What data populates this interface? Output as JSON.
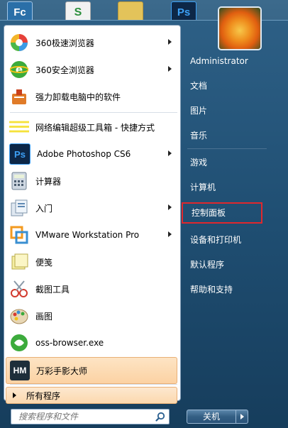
{
  "desktop": {
    "top_icons": [
      {
        "glyph": "Fc"
      },
      {
        "glyph": "S"
      },
      {
        "glyph": ""
      },
      {
        "glyph": "Ps"
      }
    ]
  },
  "left_pane": {
    "programs": [
      {
        "label": "360极速浏览器",
        "icon": "360-speed-browser-icon",
        "has_submenu": true
      },
      {
        "label": "360安全浏览器",
        "icon": "360-safe-browser-icon",
        "has_submenu": true
      },
      {
        "label": "强力卸载电脑中的软件",
        "icon": "uninstaller-icon",
        "has_submenu": false
      },
      {
        "label": "网络编辑超级工具箱 - 快捷方式",
        "icon": "toolbox-shortcut-icon",
        "has_submenu": false
      },
      {
        "label": "Adobe Photoshop CS6",
        "icon": "photoshop-icon",
        "has_submenu": true
      },
      {
        "label": "计算器",
        "icon": "calculator-icon",
        "has_submenu": false
      },
      {
        "label": "入门",
        "icon": "getting-started-icon",
        "has_submenu": true
      },
      {
        "label": "VMware Workstation Pro",
        "icon": "vmware-icon",
        "has_submenu": true
      },
      {
        "label": "便笺",
        "icon": "sticky-notes-icon",
        "has_submenu": false
      },
      {
        "label": "截图工具",
        "icon": "snipping-tool-icon",
        "has_submenu": false
      },
      {
        "label": "画图",
        "icon": "paint-icon",
        "has_submenu": false
      },
      {
        "label": "oss-browser.exe",
        "icon": "oss-browser-icon",
        "has_submenu": false
      },
      {
        "label": "万彩手影大师",
        "icon": "wancai-icon",
        "has_submenu": false
      }
    ],
    "all_programs_label": "所有程序",
    "search_placeholder": "搜索程序和文件"
  },
  "right_pane": {
    "items": [
      {
        "label": "Administrator"
      },
      {
        "label": "文档"
      },
      {
        "label": "图片"
      },
      {
        "label": "音乐"
      },
      {
        "label": "游戏"
      },
      {
        "label": "计算机"
      },
      {
        "label": "控制面板",
        "selected": true
      },
      {
        "label": "设备和打印机"
      },
      {
        "label": "默认程序"
      },
      {
        "label": "帮助和支持"
      }
    ],
    "shutdown_label": "关机"
  },
  "colors": {
    "highlight_bg": "#fcd2a3",
    "selection_border": "#e0282d",
    "pane_bg": "#1f4e72"
  }
}
